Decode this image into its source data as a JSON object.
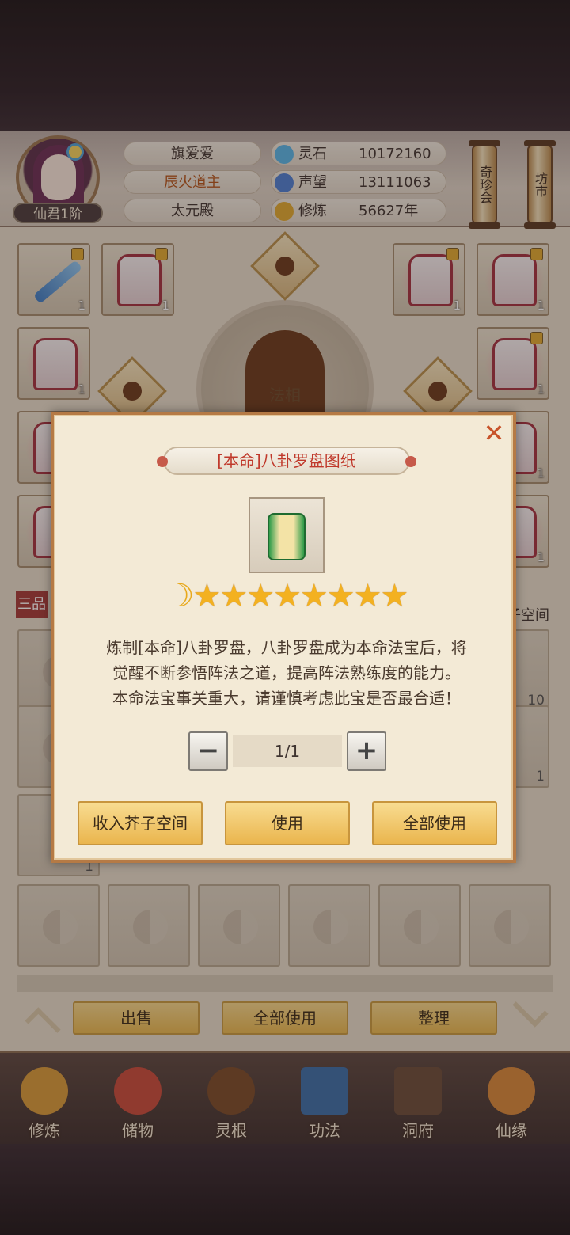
{
  "header": {
    "rank": "仙君1阶",
    "player_name": "旗爱爱",
    "title": "辰火道主",
    "palace": "太元殿",
    "resources": [
      {
        "label": "灵石",
        "value": "10172160",
        "icon": "spirit-stone-icon",
        "color": "#58b5e8"
      },
      {
        "label": "声望",
        "value": "13111063",
        "icon": "prestige-crystal-icon",
        "color": "#4d7ed3"
      },
      {
        "label": "修炼",
        "value": "56627年",
        "icon": "meditation-icon",
        "color": "#e0a930"
      }
    ],
    "side_buttons": [
      "奇珍会",
      "坊市"
    ]
  },
  "equipment": {
    "faxiang_label": "法相",
    "slot_counts": [
      "1",
      "1",
      "1",
      "1",
      "1",
      "1",
      "1",
      "1",
      "1"
    ]
  },
  "bag": {
    "section_label": "三品",
    "counts": [
      "10",
      "1",
      "1"
    ],
    "space_label": "子空间"
  },
  "actions": {
    "sell": "出售",
    "use_all": "全部使用",
    "sort": "整理"
  },
  "nav": [
    {
      "label": "修炼",
      "icon": "cultivate-icon",
      "color": "#d89a3a"
    },
    {
      "label": "储物",
      "icon": "storage-bag-icon",
      "color": "#c84b3b"
    },
    {
      "label": "灵根",
      "icon": "spirit-root-icon",
      "color": "#7a4a28"
    },
    {
      "label": "功法",
      "icon": "technique-book-icon",
      "color": "#3b6ea8"
    },
    {
      "label": "洞府",
      "icon": "cave-mansion-icon",
      "color": "#6a4c3a"
    },
    {
      "label": "仙缘",
      "icon": "gourd-icon",
      "color": "#d8873a"
    }
  ],
  "dialog": {
    "title": "[本命]八卦罗盘图纸",
    "item_icon": "scroll-blueprint-icon",
    "moon_glyph": "☽",
    "star_glyphs": [
      "★",
      "★",
      "★",
      "★",
      "★",
      "★",
      "★",
      "★"
    ],
    "star_count": 8,
    "description_lines": [
      "炼制[本命]八卦罗盘，八卦罗盘成为本命法宝后，将",
      "觉醒不断参悟阵法之道，提高阵法熟练度的能力。",
      "本命法宝事关重大，请谨慎考虑此宝是否最合适！"
    ],
    "quantity": "1/1",
    "minus": "−",
    "plus": "+",
    "close": "✕",
    "buttons": {
      "store": "收入芥子空间",
      "use": "使用",
      "use_all": "全部使用"
    }
  }
}
